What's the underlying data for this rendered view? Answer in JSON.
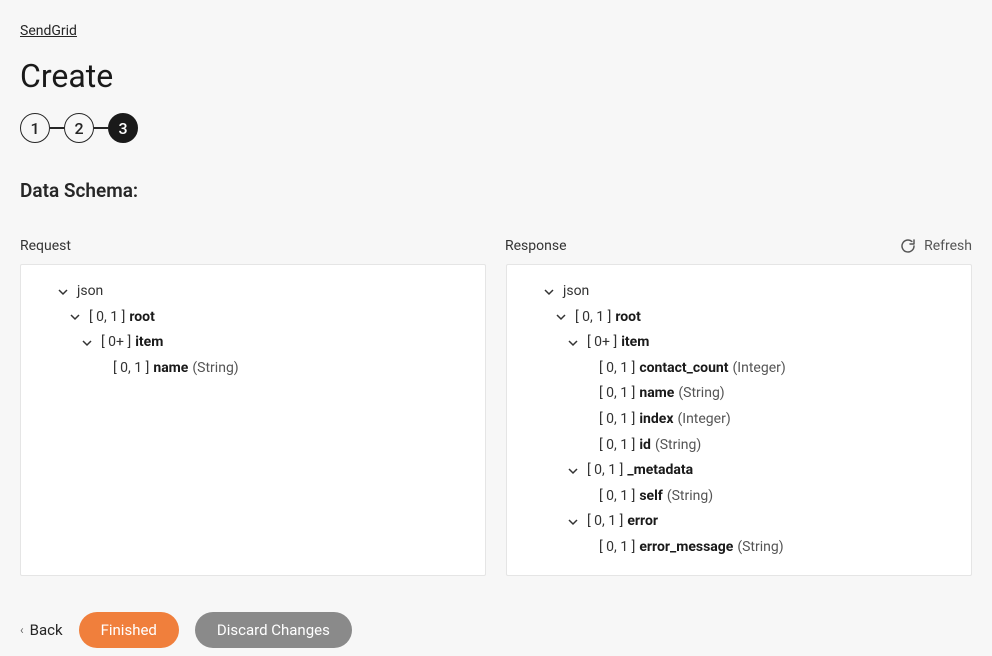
{
  "breadcrumb": {
    "label": "SendGrid"
  },
  "page": {
    "title": "Create"
  },
  "stepper": {
    "steps": [
      "1",
      "2",
      "3"
    ],
    "activeIndex": 2
  },
  "section": {
    "title": "Data Schema:"
  },
  "refresh": {
    "label": "Refresh"
  },
  "panels": {
    "request": {
      "label": "Request",
      "root_label": "json",
      "tree": [
        {
          "indent": 1,
          "expand": true,
          "cardinality": "[ 0, 1 ]",
          "name": "root",
          "type": ""
        },
        {
          "indent": 2,
          "expand": true,
          "cardinality": "[ 0+ ]",
          "name": "item",
          "type": ""
        },
        {
          "indent": 3,
          "expand": false,
          "cardinality": "[ 0, 1 ]",
          "name": "name",
          "type": "(String)"
        }
      ]
    },
    "response": {
      "label": "Response",
      "root_label": "json",
      "tree": [
        {
          "indent": 1,
          "expand": true,
          "cardinality": "[ 0, 1 ]",
          "name": "root",
          "type": ""
        },
        {
          "indent": 2,
          "expand": true,
          "cardinality": "[ 0+ ]",
          "name": "item",
          "type": ""
        },
        {
          "indent": 3,
          "expand": false,
          "cardinality": "[ 0, 1 ]",
          "name": "contact_count",
          "type": "(Integer)"
        },
        {
          "indent": 3,
          "expand": false,
          "cardinality": "[ 0, 1 ]",
          "name": "name",
          "type": "(String)"
        },
        {
          "indent": 3,
          "expand": false,
          "cardinality": "[ 0, 1 ]",
          "name": "index",
          "type": "(Integer)"
        },
        {
          "indent": 3,
          "expand": false,
          "cardinality": "[ 0, 1 ]",
          "name": "id",
          "type": "(String)"
        },
        {
          "indent": 2,
          "expand": true,
          "cardinality": "[ 0, 1 ]",
          "name": "_metadata",
          "type": ""
        },
        {
          "indent": 3,
          "expand": false,
          "cardinality": "[ 0, 1 ]",
          "name": "self",
          "type": "(String)"
        },
        {
          "indent": 2,
          "expand": true,
          "cardinality": "[ 0, 1 ]",
          "name": "error",
          "type": ""
        },
        {
          "indent": 3,
          "expand": false,
          "cardinality": "[ 0, 1 ]",
          "name": "error_message",
          "type": "(String)"
        }
      ]
    }
  },
  "footer": {
    "back": "Back",
    "finished": "Finished",
    "discard": "Discard Changes"
  }
}
